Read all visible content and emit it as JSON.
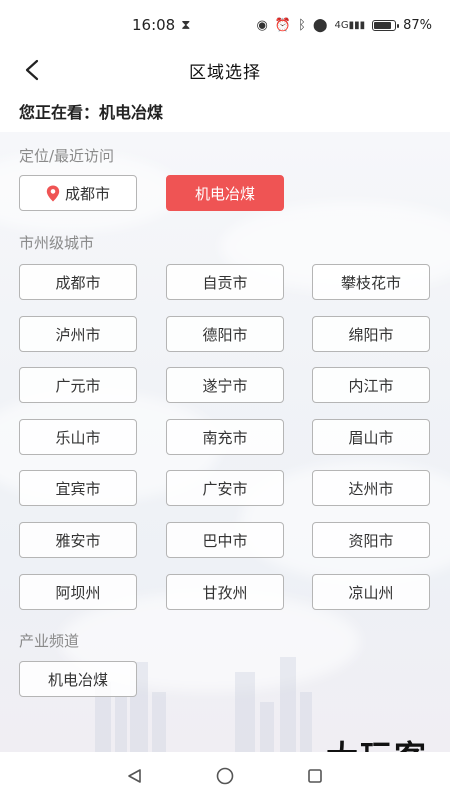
{
  "status": {
    "time": "16:08",
    "battery": "87%",
    "network": "4G"
  },
  "header": {
    "title": "区域选择"
  },
  "current": {
    "label": "您正在看：",
    "value": "机电冶煤"
  },
  "sections": {
    "recent": {
      "label": "定位/最近访问",
      "location": "成都市",
      "recent_item": "机电冶煤"
    },
    "cities": {
      "label": "市州级城市",
      "items": [
        "成都市",
        "自贡市",
        "攀枝花市",
        "泸州市",
        "德阳市",
        "绵阳市",
        "广元市",
        "遂宁市",
        "内江市",
        "乐山市",
        "南充市",
        "眉山市",
        "宜宾市",
        "广安市",
        "达州市",
        "雅安市",
        "巴中市",
        "资阳市",
        "阿坝州",
        "甘孜州",
        "凉山州"
      ]
    },
    "industry": {
      "label": "产业频道",
      "items": [
        "机电冶煤"
      ]
    }
  },
  "watermark": "大玩客",
  "colors": {
    "accent": "#ef5454",
    "border": "#b5b5b5",
    "label": "#8a8a8a"
  }
}
